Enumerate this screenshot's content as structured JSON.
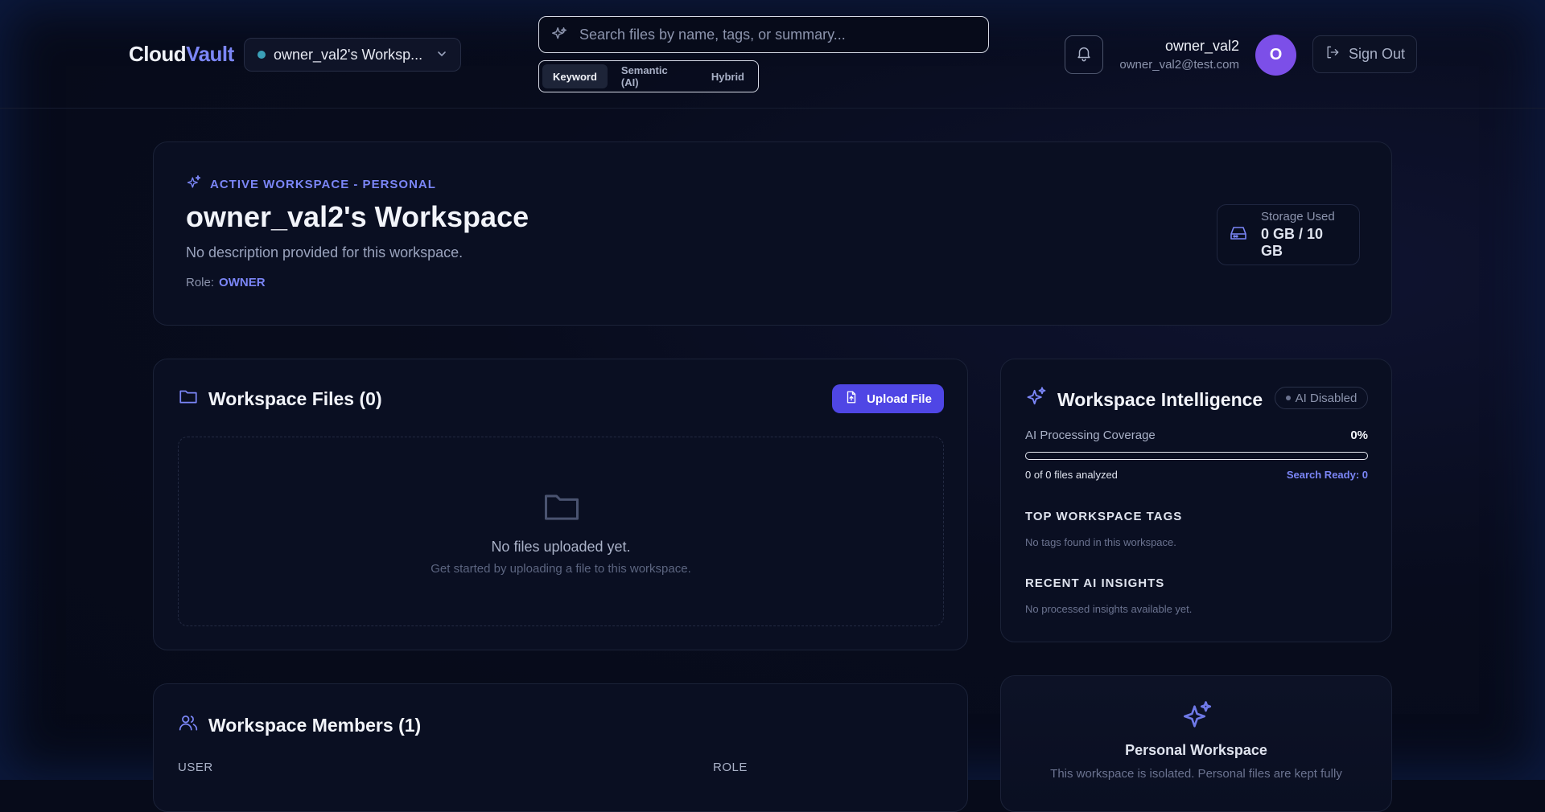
{
  "header": {
    "brand_main": "Cloud",
    "brand_accent": "Vault",
    "workspace_selector": "owner_val2's Worksp...",
    "search_placeholder": "Search files by name, tags, or summary...",
    "search_modes": [
      "Keyword",
      "Semantic (AI)",
      "Hybrid"
    ],
    "active_mode": "Keyword",
    "user_name": "owner_val2",
    "user_email": "owner_val2@test.com",
    "avatar_initial": "O",
    "sign_out": "Sign Out"
  },
  "hero": {
    "tagline": "ACTIVE WORKSPACE - PERSONAL",
    "title": "owner_val2's Workspace",
    "description": "No description provided for this workspace.",
    "role_label": "Role:",
    "role_value": "OWNER",
    "storage_label": "Storage Used",
    "storage_value": "0 GB / 10 GB"
  },
  "files": {
    "title": "Workspace Files (0)",
    "upload_label": "Upload File",
    "empty_title": "No files uploaded yet.",
    "empty_hint": "Get started by uploading a file to this workspace."
  },
  "intelligence": {
    "title": "Workspace Intelligence",
    "badge": "AI Disabled",
    "coverage_label": "AI Processing Coverage",
    "coverage_value": "0%",
    "coverage_fraction": 0,
    "files_analyzed": "0 of 0 files analyzed",
    "search_ready": "Search Ready: 0",
    "tags_heading": "TOP WORKSPACE TAGS",
    "tags_note": "No tags found in this workspace.",
    "insights_heading": "RECENT AI INSIGHTS",
    "insights_note": "No processed insights available yet."
  },
  "members": {
    "title": "Workspace Members (1)",
    "columns": [
      "USER",
      "ROLE"
    ]
  },
  "personal": {
    "title": "Personal Workspace",
    "description": "This workspace is isolated. Personal files are kept fully"
  },
  "colors": {
    "accent": "#7b86f7",
    "primary_button": "#4f46e5",
    "avatar": "#7c4fe8",
    "background": "#070b1a"
  }
}
